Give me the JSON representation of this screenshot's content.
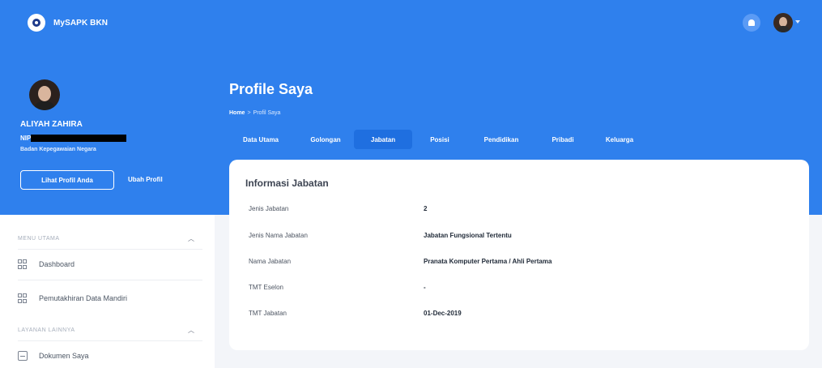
{
  "app": {
    "name": "MySAPK BKN"
  },
  "profile": {
    "name": "ALIYAH ZAHIRA",
    "nip_label": "NIP",
    "org": "Badan Kepegawaian Negara",
    "view_button": "Lihat Profil Anda",
    "edit_link": "Ubah Profil"
  },
  "sidebar": {
    "sections": [
      {
        "label": "MENU UTAMA",
        "items": [
          {
            "label": "Dashboard",
            "icon": "grid-icon"
          },
          {
            "label": "Pemutakhiran Data Mandiri",
            "icon": "grid-icon"
          }
        ]
      },
      {
        "label": "LAYANAN LAINNYA",
        "items": [
          {
            "label": "Dokumen Saya",
            "icon": "document-icon"
          }
        ]
      }
    ]
  },
  "page": {
    "title": "Profile Saya",
    "breadcrumb": {
      "home": "Home",
      "separator": ">",
      "current": "Profil Saya"
    }
  },
  "tabs": [
    {
      "label": "Data Utama",
      "active": false
    },
    {
      "label": "Golongan",
      "active": false
    },
    {
      "label": "Jabatan",
      "active": true
    },
    {
      "label": "Posisi",
      "active": false
    },
    {
      "label": "Pendidikan",
      "active": false
    },
    {
      "label": "Pribadi",
      "active": false
    },
    {
      "label": "Keluarga",
      "active": false
    }
  ],
  "card": {
    "title": "Informasi Jabatan",
    "rows": [
      {
        "label": "Jenis Jabatan",
        "value": "2"
      },
      {
        "label": "Jenis Nama Jabatan",
        "value": "Jabatan Fungsional Tertentu"
      },
      {
        "label": "Nama Jabatan",
        "value": "Pranata Komputer Pertama / Ahli Pertama"
      },
      {
        "label": "TMT Eselon",
        "value": "-"
      },
      {
        "label": "TMT Jabatan",
        "value": "01-Dec-2019"
      }
    ]
  },
  "colors": {
    "primary": "#2f80ed",
    "active_tab": "#1f6fe0",
    "background": "#f3f5f9"
  }
}
